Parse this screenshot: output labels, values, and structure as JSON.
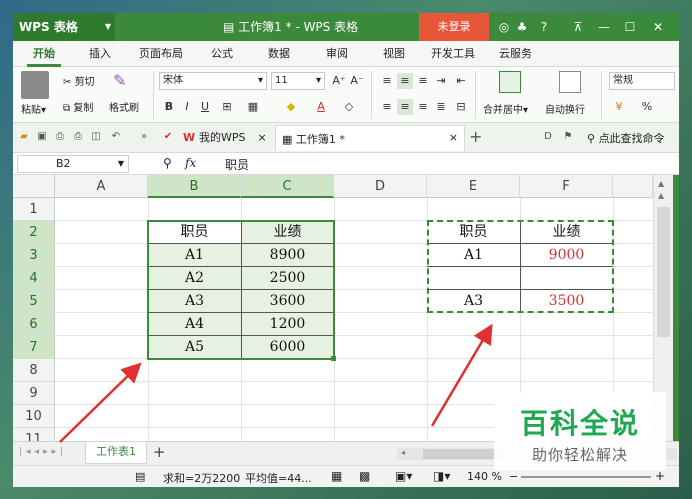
{
  "app": {
    "logo": "WPS 表格",
    "document_title": "工作簿1 * - WPS 表格",
    "login_button": "未登录"
  },
  "menu": {
    "tabs": [
      "开始",
      "插入",
      "页面布局",
      "公式",
      "数据",
      "审阅",
      "视图",
      "开发工具",
      "云服务"
    ]
  },
  "ribbon": {
    "paste": "粘贴",
    "cut": "剪切",
    "copy": "复制",
    "format_painter": "格式刷",
    "font_name": "宋体",
    "font_size": "11",
    "merge_center": "合并居中",
    "wrap_text": "自动换行",
    "number_format": "常规",
    "percent": "%"
  },
  "quickbar": {
    "my_wps_tab": "我的WPS",
    "doc_tab": "工作簿1 *",
    "search_commands": "点此查找命令"
  },
  "formula": {
    "cell_ref": "B2",
    "fx": "fx",
    "content": "职员"
  },
  "grid": {
    "columns": [
      "A",
      "B",
      "C",
      "D",
      "E",
      "F"
    ],
    "rows": [
      "1",
      "2",
      "3",
      "4",
      "5",
      "6",
      "7",
      "8",
      "9",
      "10",
      "11"
    ],
    "left_table": {
      "headers": [
        "职员",
        "业绩"
      ],
      "rows": [
        [
          "A1",
          "8900"
        ],
        [
          "A2",
          "2500"
        ],
        [
          "A3",
          "3600"
        ],
        [
          "A4",
          "1200"
        ],
        [
          "A5",
          "6000"
        ]
      ]
    },
    "right_table": {
      "headers": [
        "职员",
        "业绩"
      ],
      "rows": [
        [
          "A1",
          "9000"
        ],
        [
          "",
          ""
        ],
        [
          "A3",
          "3500"
        ]
      ]
    }
  },
  "sheets": {
    "active": "工作表1",
    "add": "+"
  },
  "status": {
    "sum": "求和=2万2200",
    "average": "平均值=44...",
    "zoom": "140 %"
  },
  "watermark": {
    "title": "百科全说",
    "subtitle": "助你轻松解决"
  },
  "colors": {
    "wps_green": "#3b8a3b",
    "login_red": "#e8563a",
    "selection_green": "#3b8a3b",
    "red_text": "#d83030",
    "arrow_red": "#e03030",
    "watermark_green": "#1fa84f"
  }
}
